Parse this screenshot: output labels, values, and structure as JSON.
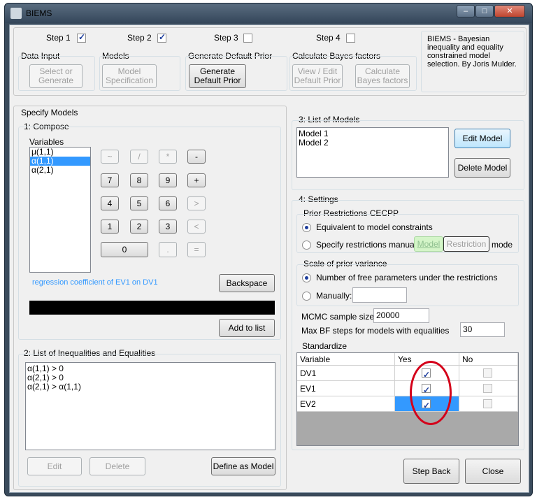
{
  "window": {
    "title": "BIEMS"
  },
  "steps": [
    {
      "label": "Step 1",
      "checked": true,
      "group": "Data Input",
      "buttons": [
        "Select or Generate"
      ]
    },
    {
      "label": "Step 2",
      "checked": true,
      "group": "Models",
      "buttons": [
        "Model Specification"
      ]
    },
    {
      "label": "Step 3",
      "checked": false,
      "group": "Generate Default Prior",
      "buttons": [
        "Generate Default Prior"
      ]
    },
    {
      "label": "Step 4",
      "checked": false,
      "group": "Calculate Bayes factors",
      "buttons": [
        "View / Edit Default Prior",
        "Calculate Bayes factors"
      ]
    }
  ],
  "about": "BIEMS - Bayesian inequality and equality constrained model selection. By Joris Mulder.",
  "specify": {
    "title": "Specify Models",
    "compose": {
      "title": "1: Compose",
      "variables_label": "Variables",
      "variables": [
        "μ(1,1)",
        "α(1,1)",
        "α(2,1)"
      ],
      "selected_index": 1,
      "keypad": [
        "~",
        "/",
        "*",
        "-",
        "7",
        "8",
        "9",
        "+",
        "4",
        "5",
        "6",
        ">",
        "1",
        "2",
        "3",
        "<",
        "0",
        ".",
        "="
      ],
      "description": "regression coefficient of EV1 on DV1",
      "backspace": "Backspace",
      "add_to_list": "Add to list"
    },
    "list": {
      "title": "2: List of Inequalities and Equalities",
      "items": [
        "α(1,1) > 0",
        "α(2,1) > 0",
        "α(2,1) > α(1,1)"
      ],
      "edit": "Edit",
      "delete": "Delete",
      "define": "Define as Model"
    }
  },
  "models": {
    "title": "3: List of Models",
    "items": [
      "Model 1",
      "Model 2"
    ],
    "edit": "Edit Model",
    "delete": "Delete Model"
  },
  "settings": {
    "title": "4: Settings",
    "prior": {
      "title": "Prior Restrictions CECPP",
      "opt1": "Equivalent to model constraints",
      "opt2": "Specify restrictions manually",
      "model_btn": "Model",
      "restriction_btn": "Restriction",
      "mode": "mode"
    },
    "scale": {
      "title": "Scale of prior variance",
      "opt1": "Number of free parameters under the restrictions",
      "opt2": "Manually:",
      "manual_value": ""
    },
    "mcmc_label": "MCMC sample size:",
    "mcmc_value": "20000",
    "maxbf_label": "Max BF steps for models with equalities",
    "maxbf_value": "30",
    "standardize": {
      "title": "Standardize",
      "headers": [
        "Variable",
        "Yes",
        "No"
      ],
      "rows": [
        {
          "variable": "DV1",
          "yes": true,
          "no": false
        },
        {
          "variable": "EV1",
          "yes": true,
          "no": false
        },
        {
          "variable": "EV2",
          "yes": true,
          "no": false
        }
      ]
    }
  },
  "footer": {
    "step_back": "Step Back",
    "close": "Close"
  }
}
